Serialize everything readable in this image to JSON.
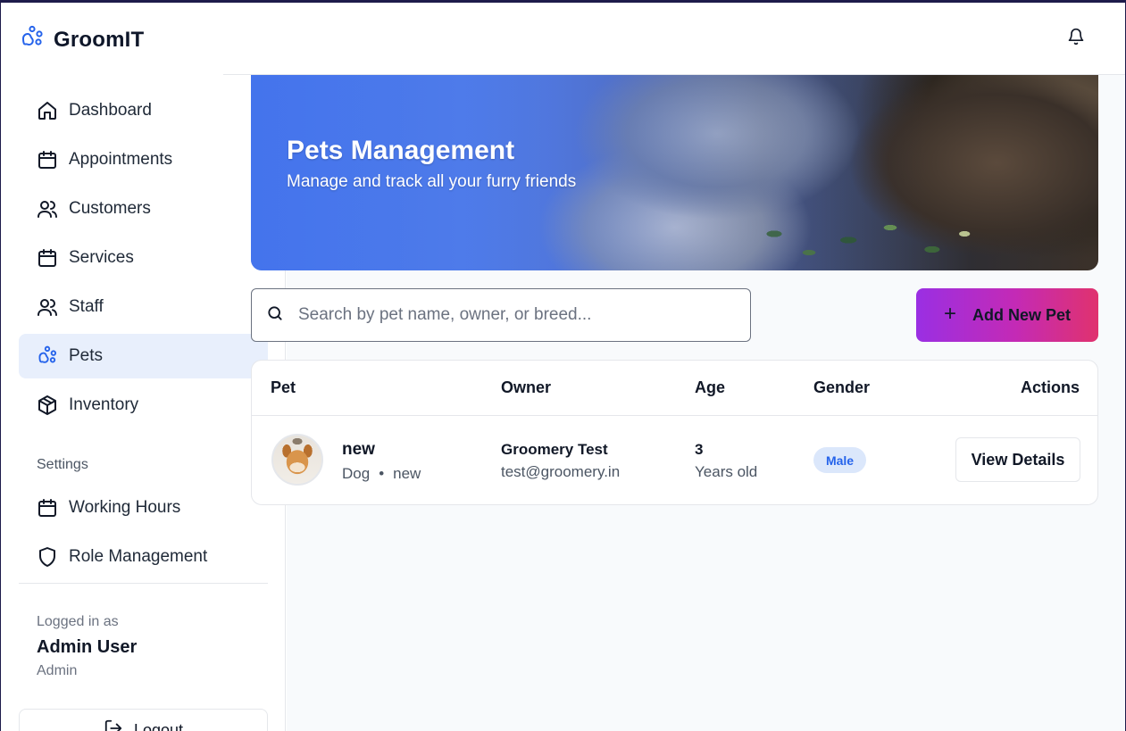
{
  "app": {
    "title": "GroomIT"
  },
  "header": {
    "notifications_icon": "bell-icon"
  },
  "sidebar": {
    "items": [
      {
        "label": "Dashboard",
        "icon": "home-icon",
        "active": false
      },
      {
        "label": "Appointments",
        "icon": "calendar-icon",
        "active": false
      },
      {
        "label": "Customers",
        "icon": "users-icon",
        "active": false
      },
      {
        "label": "Services",
        "icon": "calendar-icon",
        "active": false
      },
      {
        "label": "Staff",
        "icon": "users-icon",
        "active": false
      },
      {
        "label": "Pets",
        "icon": "paw-icon",
        "active": true
      },
      {
        "label": "Inventory",
        "icon": "box-icon",
        "active": false
      }
    ],
    "settings_label": "Settings",
    "settings_items": [
      {
        "label": "Working Hours",
        "icon": "calendar-icon"
      },
      {
        "label": "Role Management",
        "icon": "shield-icon"
      }
    ],
    "user": {
      "logged_in_label": "Logged in as",
      "name": "Admin User",
      "role": "Admin"
    },
    "logout_label": "Logout"
  },
  "hero": {
    "title": "Pets Management",
    "subtitle": "Manage and track all your furry friends"
  },
  "search": {
    "placeholder": "Search by pet name, owner, or breed...",
    "value": ""
  },
  "add_button": {
    "label": "Add New Pet"
  },
  "table": {
    "headers": {
      "pet": "Pet",
      "owner": "Owner",
      "age": "Age",
      "gender": "Gender",
      "actions": "Actions"
    },
    "rows": [
      {
        "pet_name": "new",
        "species": "Dog",
        "separator": "•",
        "breed": "new",
        "owner_name": "Groomery Test",
        "owner_email": "test@groomery.in",
        "age": "3",
        "age_unit": "Years old",
        "gender": "Male",
        "action_label": "View Details"
      }
    ]
  },
  "colors": {
    "brand": "#2563eb",
    "active_nav_bg": "#e8effc",
    "button_gradient_start": "#9a2fe3",
    "button_gradient_end": "#e0326e",
    "badge_bg": "#dbe7fb"
  }
}
